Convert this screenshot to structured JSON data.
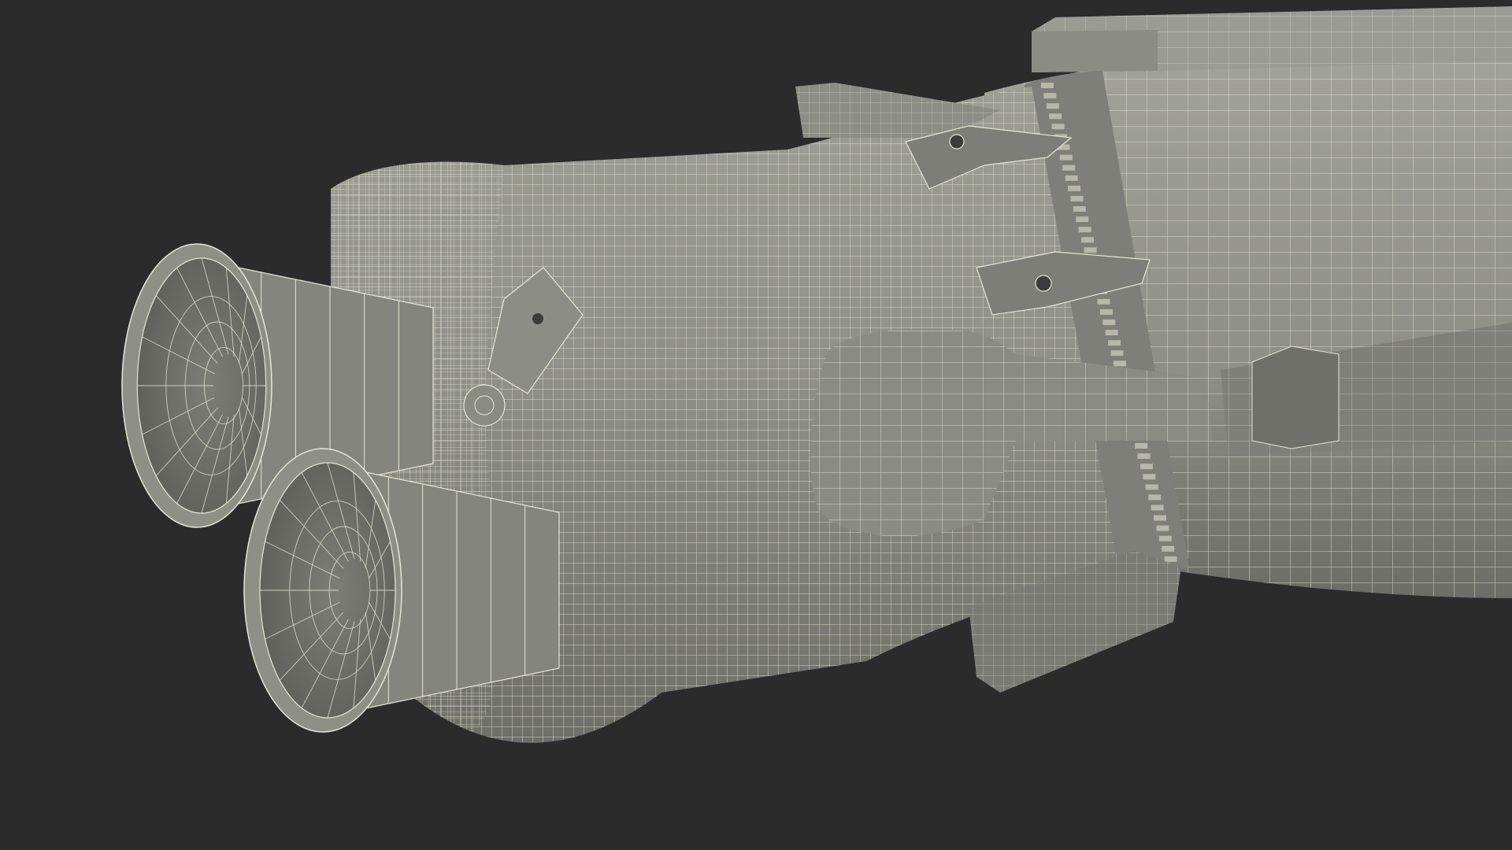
{
  "scene": {
    "subject": "rocket-stage-wireframe-render",
    "colors": {
      "background": "#2b2b2b",
      "surface": "#8e8f86",
      "surface_light": "#a9aaa1",
      "surface_dark": "#5d5e58",
      "interior": "#6f706a",
      "wire": "#e6e5d3"
    }
  }
}
